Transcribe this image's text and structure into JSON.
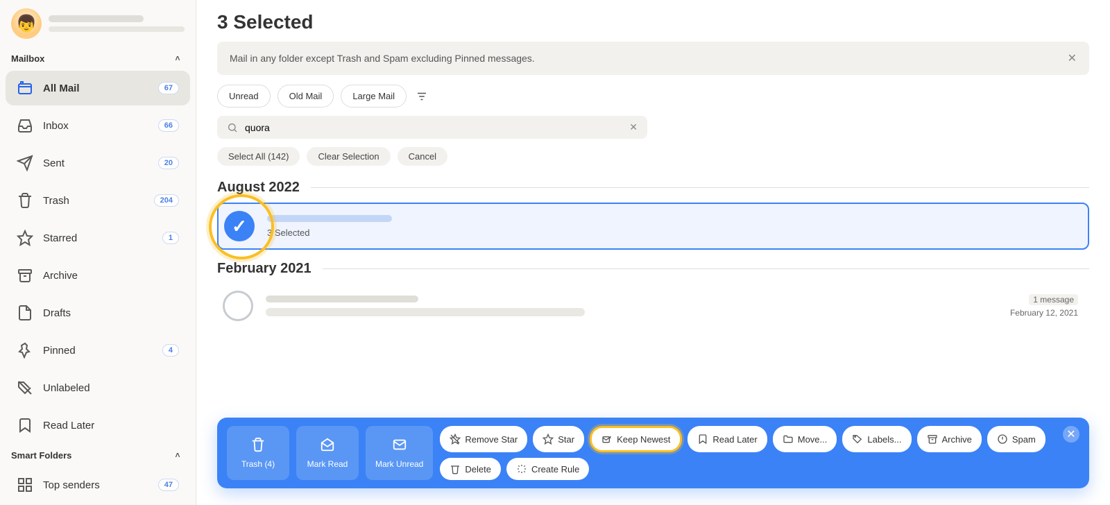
{
  "sidebar": {
    "section_mailbox": "Mailbox",
    "section_smart": "Smart Folders",
    "items": [
      {
        "label": "All Mail",
        "count": "67"
      },
      {
        "label": "Inbox",
        "count": "66"
      },
      {
        "label": "Sent",
        "count": "20"
      },
      {
        "label": "Trash",
        "count": "204"
      },
      {
        "label": "Starred",
        "count": "1"
      },
      {
        "label": "Archive",
        "count": ""
      },
      {
        "label": "Drafts",
        "count": ""
      },
      {
        "label": "Pinned",
        "count": "4"
      },
      {
        "label": "Unlabeled",
        "count": ""
      },
      {
        "label": "Read Later",
        "count": ""
      }
    ],
    "smart_items": [
      {
        "label": "Top senders",
        "count": "47"
      }
    ]
  },
  "header": {
    "title": "3 Selected",
    "info": "Mail in any folder except Trash and Spam excluding Pinned messages."
  },
  "filters": {
    "unread": "Unread",
    "old": "Old Mail",
    "large": "Large Mail"
  },
  "search": {
    "value": "quora"
  },
  "selection_actions": {
    "select_all": "Select All (142)",
    "clear": "Clear Selection",
    "cancel": "Cancel"
  },
  "groups": [
    {
      "title": "August 2022",
      "selected_caption": "3 Selected"
    },
    {
      "title": "February 2021",
      "meta_count": "1 message",
      "meta_date": "February 12, 2021"
    }
  ],
  "actionbar": {
    "trash": "Trash (4)",
    "mark_read": "Mark Read",
    "mark_unread": "Mark Unread",
    "remove_star": "Remove Star",
    "star": "Star",
    "keep_newest": "Keep Newest",
    "read_later": "Read Later",
    "move": "Move...",
    "labels": "Labels...",
    "archive": "Archive",
    "spam": "Spam",
    "delete": "Delete",
    "create_rule": "Create Rule"
  }
}
